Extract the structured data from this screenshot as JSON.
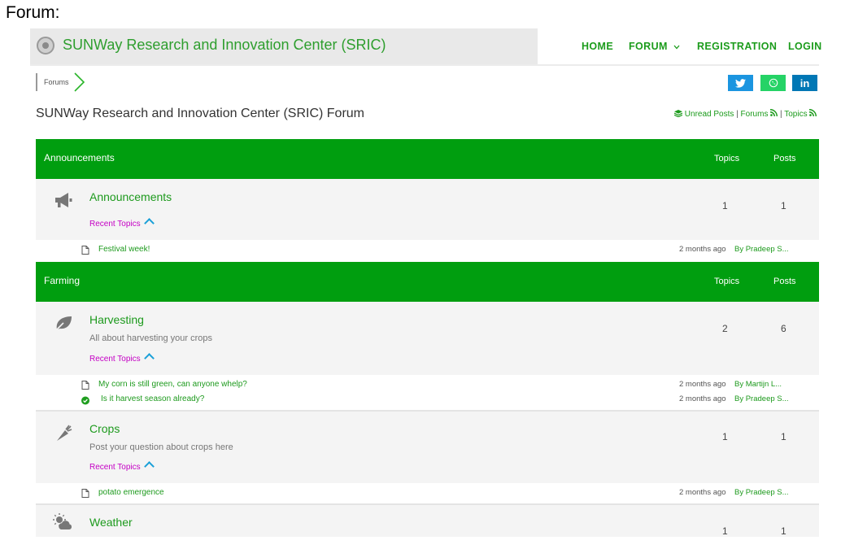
{
  "caption": "Forum:",
  "site": {
    "brand": "SUNWay Research and Innovation Center (SRIC)",
    "nav": [
      "HOME",
      "FORUM",
      "REGISTRATION",
      "LOGIN"
    ]
  },
  "breadcrumb": "Forums",
  "share": {
    "twitter": "twitter-icon",
    "whatsapp": "whatsapp-icon",
    "linkedin": "in"
  },
  "page_title": "SUNWay Research and Innovation Center (SRIC) Forum",
  "feeds": {
    "unread": "Unread Posts",
    "sep": "|",
    "forums": "Forums",
    "topics": "Topics"
  },
  "columns": {
    "topics": "Topics",
    "posts": "Posts"
  },
  "recent_label": "Recent Topics",
  "categories": [
    {
      "name": "Announcements",
      "forums": [
        {
          "icon": "megaphone-icon",
          "title": "Announcements",
          "description": "",
          "topics": "1",
          "posts": "1",
          "recent": [
            {
              "status": "document-icon",
              "title": "Festival week!",
              "time": "2 months ago",
              "by": "By Pradeep S..."
            }
          ]
        }
      ]
    },
    {
      "name": "Farming",
      "forums": [
        {
          "icon": "leaf-icon",
          "title": "Harvesting",
          "description": "All about harvesting your crops",
          "topics": "2",
          "posts": "6",
          "recent": [
            {
              "status": "document-icon",
              "title": "My corn is still green, can anyone whelp?",
              "time": "2 months ago",
              "by": "By Martijn L..."
            },
            {
              "status": "check-circle-icon",
              "title": "Is it harvest season already?",
              "time": "2 months ago",
              "by": "By Pradeep S..."
            }
          ]
        },
        {
          "icon": "carrot-icon",
          "title": "Crops",
          "description": "Post your question about crops here",
          "topics": "1",
          "posts": "1",
          "recent": [
            {
              "status": "document-icon",
              "title": "potato emergence",
              "time": "2 months ago",
              "by": "By Pradeep S..."
            }
          ]
        },
        {
          "icon": "weather-icon",
          "title": "Weather",
          "description": "",
          "topics": "1",
          "posts": "1",
          "recent": []
        }
      ]
    }
  ],
  "colors": {
    "category_bar": "#009e0f",
    "link": "#1d9a1d",
    "recent_topics": "#c400c4",
    "twitter": "#1b95e0",
    "whatsapp": "#25d366",
    "linkedin": "#0077b5"
  }
}
